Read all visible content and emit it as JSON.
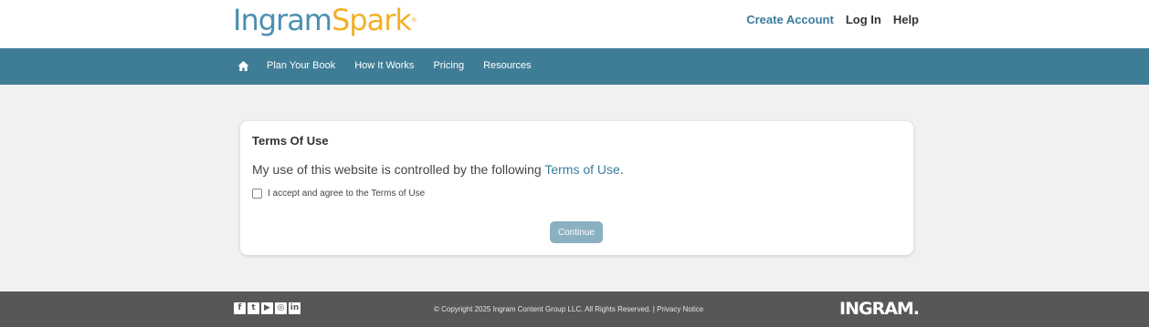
{
  "header": {
    "logo_part1": "Ingram",
    "logo_part2": "Spark",
    "logo_reg": "®",
    "links": [
      "Create Account",
      "Log In",
      "Help"
    ]
  },
  "nav": {
    "home_icon": "home-icon",
    "items": [
      "Plan Your Book",
      "How It Works",
      "Pricing",
      "Resources"
    ]
  },
  "card": {
    "title": "Terms Of Use",
    "description_prefix": "My use of this website is controlled by the following ",
    "terms_link": "Terms of Use",
    "description_suffix": ".",
    "checkbox_label": "I accept and agree to the Terms of Use",
    "checkbox_checked": false,
    "continue_label": "Continue"
  },
  "footer": {
    "social_icons": [
      "facebook-icon",
      "twitter-icon",
      "youtube-icon",
      "instagram-icon",
      "linkedin-icon"
    ],
    "copyright": "© Copyright 2025 Ingram Content Group LLC. All Rights Reserved. | ",
    "privacy_link": "Privacy Notice",
    "brand": "INGRAM."
  },
  "colors": {
    "accent": "#3f7d96",
    "link": "#3a7c9d",
    "logo_blue": "#4a8fb0",
    "logo_orange": "#f2b02a",
    "footer_bg": "#585757",
    "button_disabled": "#8bb0c1"
  }
}
